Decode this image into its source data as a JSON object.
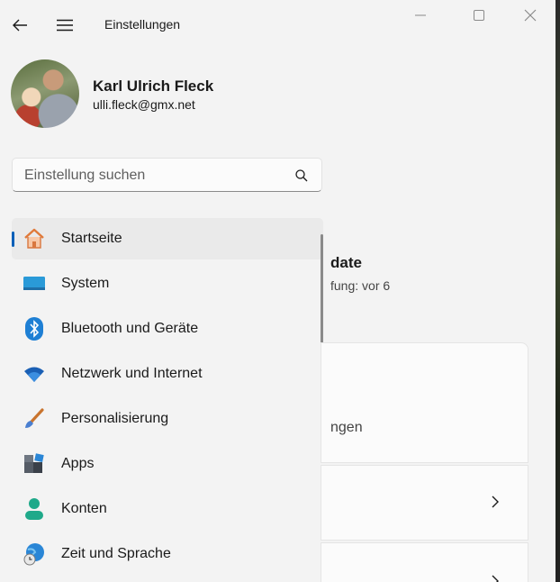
{
  "window": {
    "title": "Einstellungen"
  },
  "profile": {
    "name": "Karl Ulrich Fleck",
    "email": "ulli.fleck@gmx.net"
  },
  "search": {
    "placeholder": "Einstellung suchen"
  },
  "nav": {
    "items": [
      {
        "label": "Startseite",
        "icon": "home-icon",
        "selected": true
      },
      {
        "label": "System",
        "icon": "monitor-icon"
      },
      {
        "label": "Bluetooth und Geräte",
        "icon": "bluetooth-icon"
      },
      {
        "label": "Netzwerk und Internet",
        "icon": "wifi-icon"
      },
      {
        "label": "Personalisierung",
        "icon": "brush-icon"
      },
      {
        "label": "Apps",
        "icon": "apps-icon"
      },
      {
        "label": "Konten",
        "icon": "person-icon"
      },
      {
        "label": "Zeit und Sprache",
        "icon": "globe-clock-icon"
      }
    ]
  },
  "right_pane": {
    "heading_fragment": "date",
    "sub_fragment": "fung: vor 6",
    "card_text_fragment": "ngen"
  },
  "colors": {
    "accent": "#005fb8",
    "background": "#f3f3f3"
  }
}
